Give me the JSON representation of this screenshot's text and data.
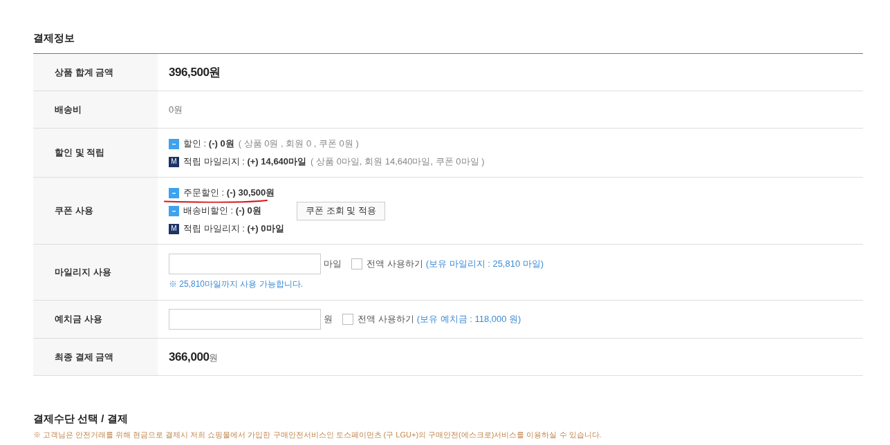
{
  "payment_info": {
    "title": "결제정보",
    "rows": [
      {
        "kind": "amount",
        "label": "상품 합계 금액",
        "value": "396,500원"
      },
      {
        "kind": "plain",
        "label": "배송비",
        "value": "0원"
      },
      {
        "kind": "lines",
        "label": "할인 및 적립",
        "lines": [
          {
            "kind": "discount",
            "text": "할인 : **(-) 0원**",
            "detail": "( 상품 0원 , 회원 0 , 쿠폰 0원 )",
            "annotated": false
          },
          {
            "kind": "mileage",
            "badge": "M",
            "text": "적립 마일리지 : **(+) 14,640마일**",
            "detail": "( 상품 0마일, 회원 14,640마일, 쿠폰 0마일 )",
            "annotated": false
          }
        ]
      },
      {
        "kind": "coupon",
        "label": "쿠폰 사용",
        "lines": [
          {
            "kind": "discount",
            "text": "주문할인 : **(-) 30,500원**",
            "annotated": true
          },
          {
            "kind": "discount",
            "text": "배송비할인 : **(-) 0원**",
            "annotated": false
          },
          {
            "kind": "mileage",
            "badge": "M",
            "text": "적립 마일리지 : **(+) 0마일**",
            "annotated": false
          }
        ],
        "button": "쿠폰 조회 및 적용"
      },
      {
        "kind": "points",
        "label": "마일리지 사용",
        "unit": "마일",
        "use_all": {
          "label": "전액 사용하기",
          "checked": false
        },
        "balance": "(보유 마일리지 : 25,810 마일)",
        "note": "※ 25,810마일까지 사용 가능합니다."
      },
      {
        "kind": "points",
        "label": "예치금 사용",
        "unit": "원",
        "use_all": {
          "label": "전액 사용하기",
          "checked": false
        },
        "balance": "(보유 예치금 : 118,000 원)"
      },
      {
        "kind": "total",
        "label": "최종 결제 금액",
        "amount": "366,000",
        "unit": "원"
      }
    ]
  },
  "payment_method": {
    "title": "결제수단 선택 / 결제",
    "notice": "※ 고객님은 안전거래를 위해 현금으로 결제시 저희 쇼핑몰에서 가입한 구매안전서비스인 토스페이먼츠 (구 LGU+)의 구매안전(에스크로)서비스를 이용하실 수 있습니다."
  }
}
